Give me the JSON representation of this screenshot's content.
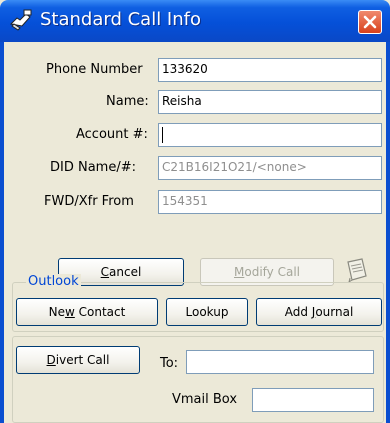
{
  "window": {
    "title": "Standard Call Info",
    "title_icon": "phone-icon",
    "close_icon": "close-icon"
  },
  "fields": {
    "phone_number": {
      "label": "Phone Number",
      "value": "133620"
    },
    "name": {
      "label": "Name:",
      "value": "Reisha"
    },
    "account": {
      "label": "Account #:",
      "value": ""
    },
    "did": {
      "label": "DID Name/#:",
      "value": "C21B16I21O21/<none>"
    },
    "fwd": {
      "label": "FWD/Xfr From",
      "value": "154351"
    }
  },
  "buttons": {
    "cancel": {
      "pre": "",
      "u": "C",
      "post": "ancel"
    },
    "modify": {
      "pre": "",
      "u": "M",
      "post": "odify Call"
    },
    "notes_icon": "notepad-icon"
  },
  "outlook": {
    "legend": "Outlook",
    "new_contact": {
      "pre": "Ne",
      "u": "w",
      "post": " Contact"
    },
    "lookup": {
      "pre": "Lookup",
      "u": "",
      "post": ""
    },
    "add_journal": {
      "pre": "Add ",
      "u": "J",
      "post": "ournal"
    }
  },
  "divert": {
    "button": {
      "pre": "",
      "u": "D",
      "post": "ivert Call"
    },
    "to_label": "To:",
    "to_value": "",
    "vmail_label": "Vmail Box",
    "vmail_value": ""
  }
}
